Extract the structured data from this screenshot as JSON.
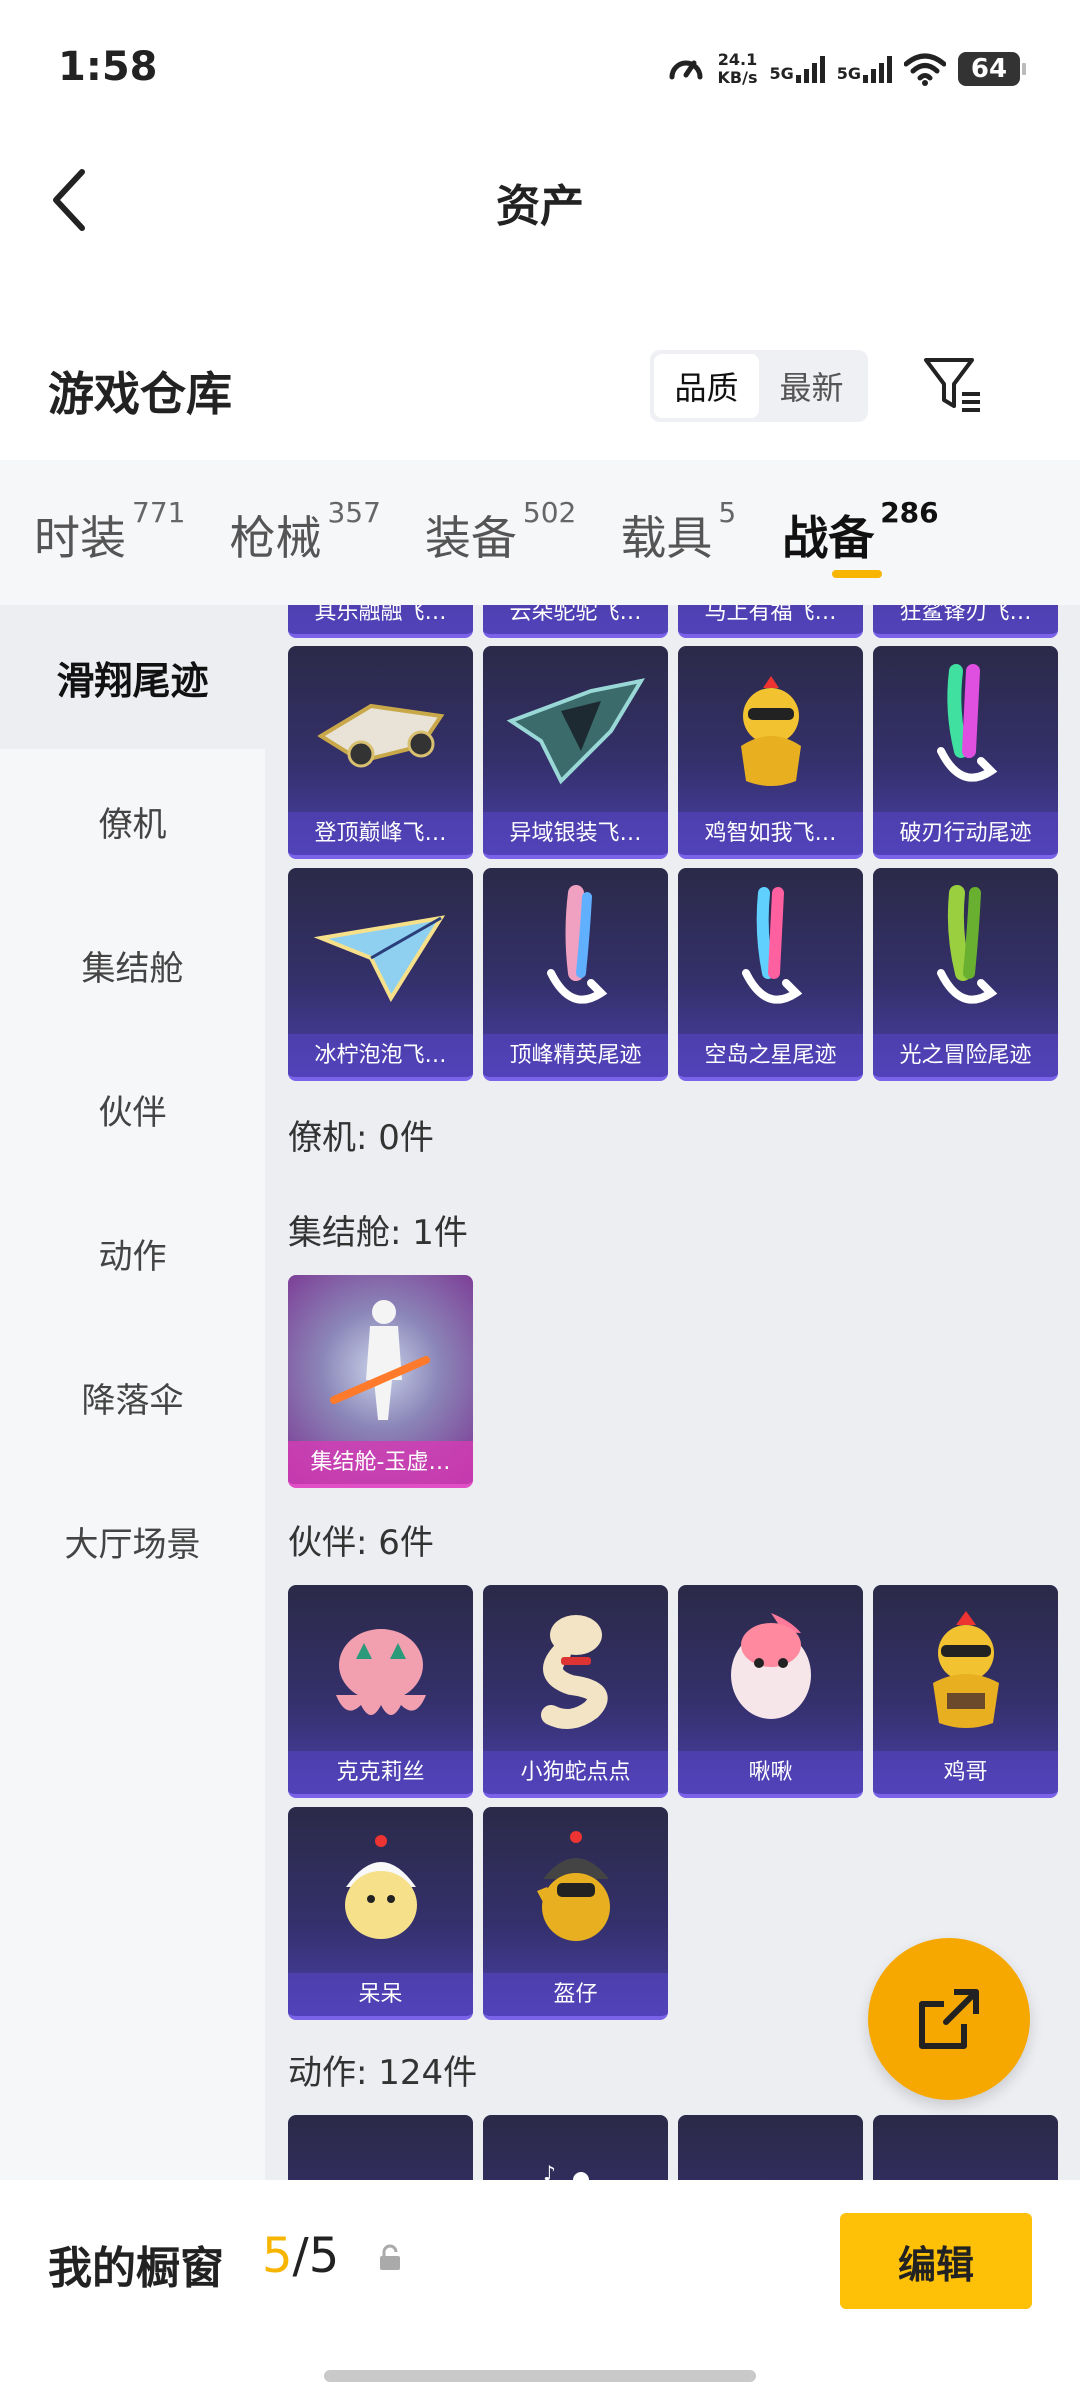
{
  "status": {
    "time": "1:58",
    "speed_value": "24.1",
    "speed_unit": "KB/s",
    "net1": "5G",
    "net2": "5G",
    "battery": "64"
  },
  "header": {
    "title": "资产"
  },
  "section": {
    "title": "游戏仓库",
    "sort_options": [
      "品质",
      "最新"
    ],
    "sort_active": "品质"
  },
  "tabs": [
    {
      "label": "时装",
      "count": "771"
    },
    {
      "label": "枪械",
      "count": "357"
    },
    {
      "label": "装备",
      "count": "502"
    },
    {
      "label": "载具",
      "count": "5"
    },
    {
      "label": "战备",
      "count": "286"
    }
  ],
  "sidebar": {
    "items": [
      "滑翔尾迹",
      "僚机",
      "集结舱",
      "伙伴",
      "动作",
      "降落伞",
      "大厅场景"
    ],
    "active": "滑翔尾迹"
  },
  "content": {
    "partial_top_row": [
      "其乐融融飞…",
      "云朵驼驼飞…",
      "马上有福飞…",
      "狂鲨锋刃飞…"
    ],
    "glide_items": [
      "登顶巅峰飞…",
      "异域银装飞…",
      "鸡智如我飞…",
      "破刃行动尾迹",
      "冰柠泡泡飞…",
      "顶峰精英尾迹",
      "空岛之星尾迹",
      "光之冒险尾迹"
    ],
    "wingman_label": "僚机: 0件",
    "capsule_label": "集结舱: 1件",
    "capsule_items": [
      "集结舱-玉虚…"
    ],
    "partner_label": "伙伴: 6件",
    "partner_items": [
      "克克莉丝",
      "小狗蛇点点",
      "啾啾",
      "鸡哥",
      "呆呆",
      "盔仔"
    ],
    "action_label": "动作: 124件"
  },
  "bottom": {
    "label": "我的橱窗",
    "count_current": "5",
    "count_sep": "/",
    "count_total": "5",
    "edit_label": "编辑"
  },
  "colors": {
    "accent": "#f7b500",
    "card_purple": "#4a3fa8",
    "card_pink": "#e04fc6"
  },
  "icons": [
    "back-arrow-icon",
    "filter-icon",
    "share-external-icon",
    "lock-icon",
    "signal-icon",
    "wifi-icon",
    "speedometer-icon"
  ]
}
